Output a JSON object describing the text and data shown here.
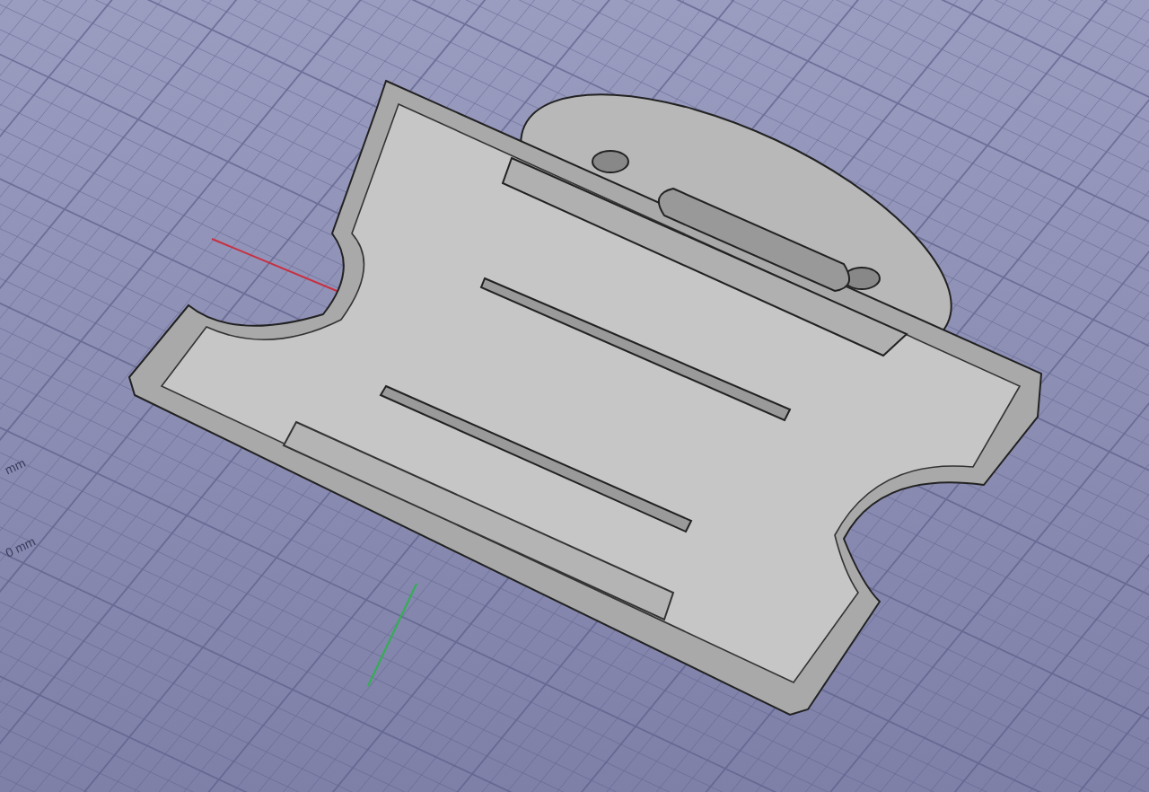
{
  "viewport": {
    "axis_labels": [
      {
        "text": "mm"
      },
      {
        "text": "0 mm"
      }
    ]
  }
}
